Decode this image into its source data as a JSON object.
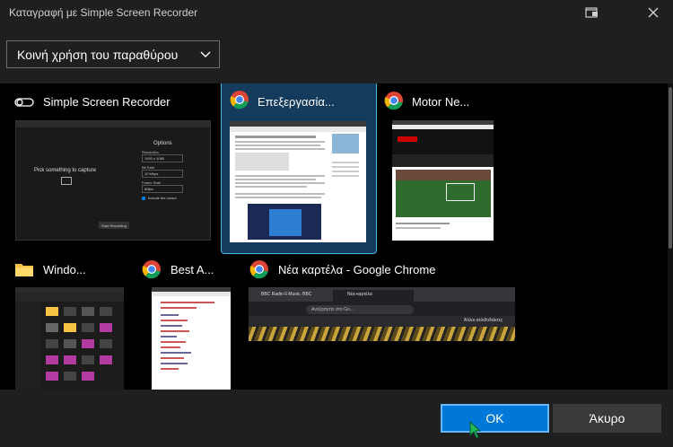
{
  "window": {
    "title": "Καταγραφή με Simple Screen Recorder"
  },
  "share_dropdown": {
    "selected": "Κοινή χρήση του παραθύρου"
  },
  "windows": [
    {
      "label": "Simple Screen Recorder",
      "icon": "toggle-icon"
    },
    {
      "label": "Επεξεργασία...",
      "icon": "chrome-icon",
      "selected": true
    },
    {
      "label": "Motor Ne...",
      "icon": "chrome-icon"
    },
    {
      "label": "Windo...",
      "icon": "folder-icon"
    },
    {
      "label": "Best A...",
      "icon": "chrome-icon"
    },
    {
      "label": "Νέα καρτέλα - Google Chrome",
      "icon": "chrome-icon"
    }
  ],
  "ssr_preview": {
    "heading": "Options",
    "prompt": "Pick something to capture",
    "resolution_label": "Resolution",
    "resolution_value": "1920 x 1080",
    "bitrate_label": "Bit Rate",
    "bitrate_value": "10 Mbps",
    "framerate_label": "Frame Rate",
    "framerate_value": "60fps",
    "cursor_label": "Include the cursor",
    "start_label": "Start Recording"
  },
  "chrome_preview": {
    "tab1": "BBC Radio 6 Music, BBC",
    "tab2": "Νέα καρτέλα",
    "search_placeholder": "Αναζητήστε στο Go...",
    "other_bookmarks": "Άλλοι σελιδοδείκτες"
  },
  "buttons": {
    "ok": "OK",
    "cancel": "Άκυρο"
  },
  "colors": {
    "accent": "#0078d7",
    "selection_border": "#4fb7e8",
    "selection_bg": "#143a5c"
  }
}
